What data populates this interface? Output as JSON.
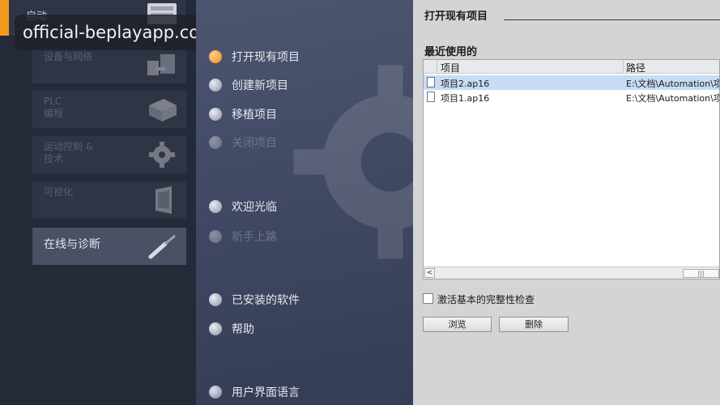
{
  "watermark": "official-beplayapp.com.cn",
  "sidebar": {
    "start_label": "启动",
    "items": [
      {
        "label": "设备与网络",
        "dim": true
      },
      {
        "label": "PLC\n编程",
        "dim": true
      },
      {
        "label": "运动控制 &\n技术",
        "dim": true
      },
      {
        "label": "可视化",
        "dim": true
      },
      {
        "label": "在线与诊断",
        "dim": false
      }
    ]
  },
  "actions": [
    {
      "label": "打开现有项目",
      "state": "active"
    },
    {
      "label": "创建新项目",
      "state": "normal"
    },
    {
      "label": "移植项目",
      "state": "normal"
    },
    {
      "label": "关闭项目",
      "state": "disabled"
    },
    {
      "label": "欢迎光临",
      "state": "normal"
    },
    {
      "label": "新手上路",
      "state": "disabled"
    },
    {
      "label": "已安装的软件",
      "state": "normal"
    },
    {
      "label": "帮助",
      "state": "normal"
    },
    {
      "label": "用户界面语言",
      "state": "globe"
    }
  ],
  "panel": {
    "title": "打开现有项目",
    "recent_title": "最近使用的",
    "columns": {
      "name": "项目",
      "path": "路径"
    },
    "rows": [
      {
        "name": "项目2.ap16",
        "path": "E:\\文档\\Automation\\项"
      },
      {
        "name": "项目1.ap16",
        "path": "E:\\文档\\Automation\\项"
      }
    ],
    "integrity_label": "激活基本的完整性检查",
    "browse_label": "浏览",
    "delete_label": "删除"
  },
  "colors": {
    "accent": "#f39a1d",
    "selected_row": "#c7dcf4"
  }
}
